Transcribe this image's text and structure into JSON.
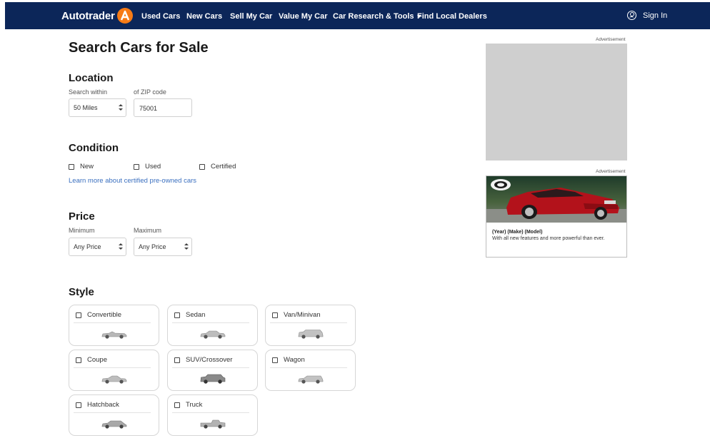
{
  "nav": {
    "logo_text": "Autotrader",
    "links": [
      "Used Cars",
      "New Cars",
      "Sell My Car",
      "Value My Car",
      "Car Research & Tools",
      "Find Local Dealers"
    ],
    "sign_in": "Sign In"
  },
  "page_title": "Search Cars for Sale",
  "location": {
    "heading": "Location",
    "search_within_label": "Search within",
    "search_within_value": "50 Miles",
    "zip_label": "of ZIP code",
    "zip_value": "75001"
  },
  "condition": {
    "heading": "Condition",
    "options": [
      "New",
      "Used",
      "Certified"
    ],
    "learn_link": "Learn more about certified pre-owned cars"
  },
  "price": {
    "heading": "Price",
    "min_label": "Minimum",
    "min_value": "Any Price",
    "max_label": "Maximum",
    "max_value": "Any Price"
  },
  "style": {
    "heading": "Style",
    "options": [
      "Convertible",
      "Sedan",
      "Van/Minivan",
      "Coupe",
      "SUV/Crossover",
      "Wagon",
      "Hatchback",
      "Truck"
    ]
  },
  "ads": {
    "label": "Advertisement",
    "card_title": "(Year) (Make) (Model)",
    "card_desc": "With all new features and more powerful than ever."
  },
  "colors": {
    "nav_bg": "#0c2659",
    "logo_orange": "#f77b16",
    "link_blue": "#3a6fbf",
    "ad_car_red": "#b3121b"
  }
}
